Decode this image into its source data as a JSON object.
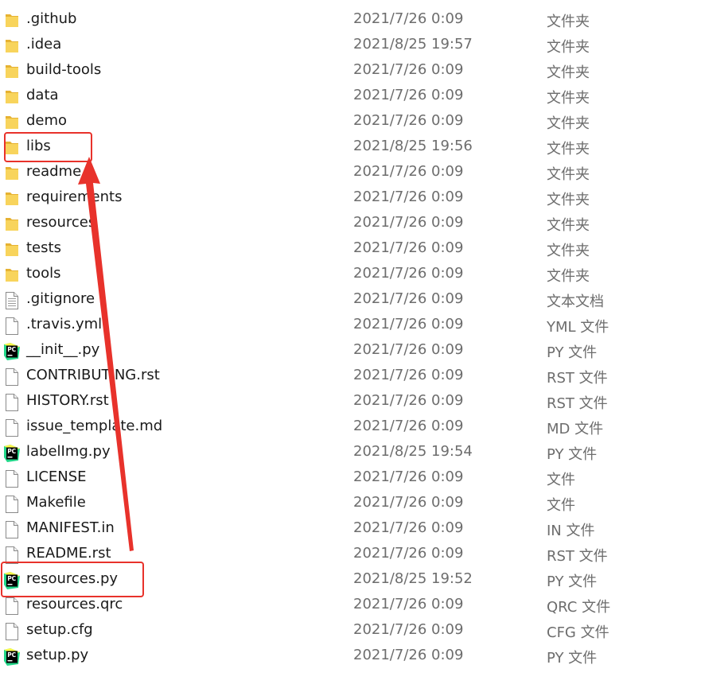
{
  "files": [
    {
      "name": ".github",
      "date": "2021/7/26 0:09",
      "type": "文件夹",
      "icon": "folder-icon"
    },
    {
      "name": ".idea",
      "date": "2021/8/25 19:57",
      "type": "文件夹",
      "icon": "folder-icon"
    },
    {
      "name": "build-tools",
      "date": "2021/7/26 0:09",
      "type": "文件夹",
      "icon": "folder-icon"
    },
    {
      "name": "data",
      "date": "2021/7/26 0:09",
      "type": "文件夹",
      "icon": "folder-icon"
    },
    {
      "name": "demo",
      "date": "2021/7/26 0:09",
      "type": "文件夹",
      "icon": "folder-icon"
    },
    {
      "name": "libs",
      "date": "2021/8/25 19:56",
      "type": "文件夹",
      "icon": "folder-icon"
    },
    {
      "name": "readme",
      "date": "2021/7/26 0:09",
      "type": "文件夹",
      "icon": "folder-icon"
    },
    {
      "name": "requirements",
      "date": "2021/7/26 0:09",
      "type": "文件夹",
      "icon": "folder-icon"
    },
    {
      "name": "resources",
      "date": "2021/7/26 0:09",
      "type": "文件夹",
      "icon": "folder-icon"
    },
    {
      "name": "tests",
      "date": "2021/7/26 0:09",
      "type": "文件夹",
      "icon": "folder-icon"
    },
    {
      "name": "tools",
      "date": "2021/7/26 0:09",
      "type": "文件夹",
      "icon": "folder-icon"
    },
    {
      "name": ".gitignore",
      "date": "2021/7/26 0:09",
      "type": "文本文档",
      "icon": "text-document-icon"
    },
    {
      "name": ".travis.yml",
      "date": "2021/7/26 0:09",
      "type": "YML 文件",
      "icon": "file-icon"
    },
    {
      "name": "__init__.py",
      "date": "2021/7/26 0:09",
      "type": "PY 文件",
      "icon": "pycharm-file-icon"
    },
    {
      "name": "CONTRIBUTING.rst",
      "date": "2021/7/26 0:09",
      "type": "RST 文件",
      "icon": "file-icon"
    },
    {
      "name": "HISTORY.rst",
      "date": "2021/7/26 0:09",
      "type": "RST 文件",
      "icon": "file-icon"
    },
    {
      "name": "issue_template.md",
      "date": "2021/7/26 0:09",
      "type": "MD 文件",
      "icon": "file-icon"
    },
    {
      "name": "labelImg.py",
      "date": "2021/8/25 19:54",
      "type": "PY 文件",
      "icon": "pycharm-file-icon"
    },
    {
      "name": "LICENSE",
      "date": "2021/7/26 0:09",
      "type": "文件",
      "icon": "file-icon"
    },
    {
      "name": "Makefile",
      "date": "2021/7/26 0:09",
      "type": "文件",
      "icon": "file-icon"
    },
    {
      "name": "MANIFEST.in",
      "date": "2021/7/26 0:09",
      "type": "IN 文件",
      "icon": "file-icon"
    },
    {
      "name": "README.rst",
      "date": "2021/7/26 0:09",
      "type": "RST 文件",
      "icon": "file-icon"
    },
    {
      "name": "resources.py",
      "date": "2021/8/25 19:52",
      "type": "PY 文件",
      "icon": "pycharm-file-icon"
    },
    {
      "name": "resources.qrc",
      "date": "2021/7/26 0:09",
      "type": "QRC 文件",
      "icon": "file-icon"
    },
    {
      "name": "setup.cfg",
      "date": "2021/7/26 0:09",
      "type": "CFG 文件",
      "icon": "file-icon"
    },
    {
      "name": "setup.py",
      "date": "2021/7/26 0:09",
      "type": "PY 文件",
      "icon": "pycharm-file-icon"
    }
  ],
  "annotation": {
    "color": "#e8322b",
    "highlighted_items": [
      "libs",
      "resources.py"
    ]
  },
  "icon_glyph": {
    "pycharm_label": "PC"
  }
}
